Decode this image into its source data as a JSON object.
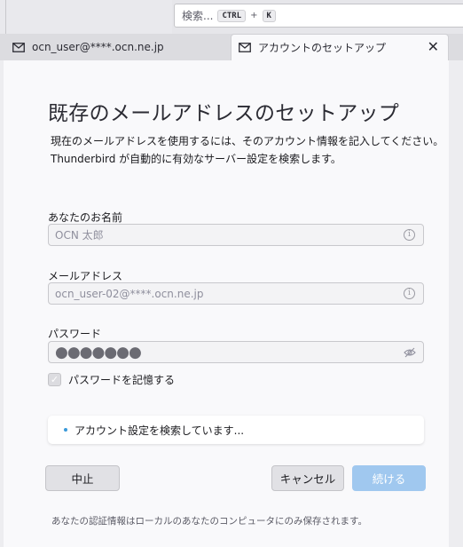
{
  "search": {
    "placeholder": "検索...",
    "shortcut_key1": "CTRL",
    "shortcut_plus": "+",
    "shortcut_key2": "K"
  },
  "tabs": [
    {
      "label": "ocn_user@****.ocn.ne.jp",
      "icon": "mail-icon",
      "active": false
    },
    {
      "label": "アカウントのセットアップ",
      "icon": "mail-icon",
      "active": true,
      "close": "✕"
    }
  ],
  "page": {
    "title": "既存のメールアドレスのセットアップ",
    "intro_line1": "現在のメールアドレスを使用するには、そのアカウント情報を記入してください。",
    "intro_line2": "Thunderbird が自動的に有効なサーバー設定を検索します。"
  },
  "form": {
    "name_label": "あなたのお名前",
    "name_value": "OCN 太郎",
    "email_label": "メールアドレス",
    "email_value": "ocn_user-02@****.ocn.ne.jp",
    "password_label": "パスワード",
    "password_value": "●●●●●●●",
    "remember_label": "パスワードを記憶する",
    "remember_checked": true
  },
  "status": {
    "text": "アカウント設定を検索しています..."
  },
  "buttons": {
    "stop": "中止",
    "cancel": "キャンセル",
    "continue": "続ける"
  },
  "footer": {
    "note": "あなたの認証情報はローカルのあなたのコンピュータにのみ保存されます。"
  },
  "colors": {
    "accent": "#a0c8ef",
    "status_bullet": "#3b9ad9",
    "page_bg": "#f9f9fb"
  }
}
